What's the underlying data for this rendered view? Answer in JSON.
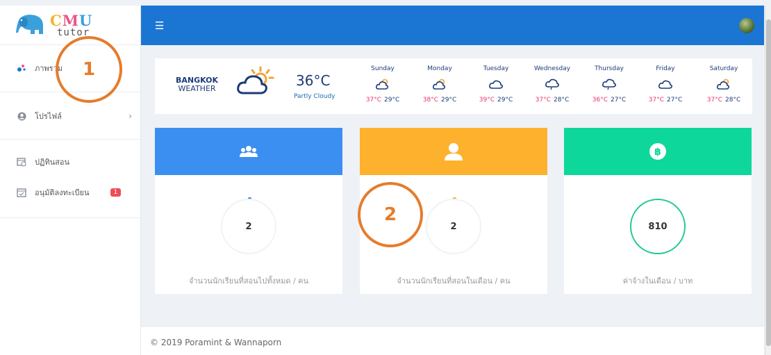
{
  "sidebar": {
    "logo": {
      "c": "C",
      "m": "M",
      "u": "U",
      "sub": "tutor"
    },
    "items": [
      {
        "label": "ภาพรวม",
        "icon": "dashboard-dots-icon"
      },
      {
        "label": "โปรไฟล์",
        "icon": "user-circle-icon"
      },
      {
        "label": "ปฏิทินสอน",
        "icon": "calendar-clock-icon"
      },
      {
        "label": "อนุมัติลงทะเบียน",
        "icon": "calendar-check-icon",
        "badge": "1"
      }
    ]
  },
  "topbar": {
    "menu_icon": "hamburger-icon",
    "avatar": "user-avatar"
  },
  "weather": {
    "city": "BANGKOK",
    "label": "WEATHER",
    "temp": "36°C",
    "condition": "Partly Cloudy",
    "days": [
      {
        "name": "Sunday",
        "icon": "sun-cloud-icon",
        "hi": "37°C",
        "lo": "29°C"
      },
      {
        "name": "Monday",
        "icon": "sun-cloud-icon",
        "hi": "38°C",
        "lo": "29°C"
      },
      {
        "name": "Tuesday",
        "icon": "cloud-icon",
        "hi": "39°C",
        "lo": "29°C"
      },
      {
        "name": "Wednesday",
        "icon": "cloud-rain-icon",
        "hi": "37°C",
        "lo": "28°C"
      },
      {
        "name": "Thursday",
        "icon": "cloud-rain-icon",
        "hi": "36°C",
        "lo": "27°C"
      },
      {
        "name": "Friday",
        "icon": "cloud-icon",
        "hi": "37°C",
        "lo": "27°C"
      },
      {
        "name": "Saturday",
        "icon": "sun-cloud-icon",
        "hi": "37°C",
        "lo": "28°C"
      }
    ]
  },
  "cards": [
    {
      "value": "2",
      "caption": "จำนวนนักเรียนที่สอนไปทั้งหมด / คน",
      "color": "#3b8ff0",
      "icon": "users-group-icon"
    },
    {
      "value": "2",
      "caption": "จำนวนนักเรียนที่สอนในเดือน / คน",
      "color": "#fdb12d",
      "icon": "user-icon"
    },
    {
      "value": "810",
      "caption": "ค่าจ้างในเดือน / บาท",
      "color": "#0dd79a",
      "icon": "bitcoin-icon"
    }
  ],
  "footer": {
    "text": "© 2019 Poramint & Wannaporn"
  },
  "annotations": [
    {
      "label": "1"
    },
    {
      "label": "2"
    }
  ],
  "colors": {
    "topbar": "#1b76d3",
    "annotation": "#e67c2c",
    "temp_high": "#e8316a"
  }
}
